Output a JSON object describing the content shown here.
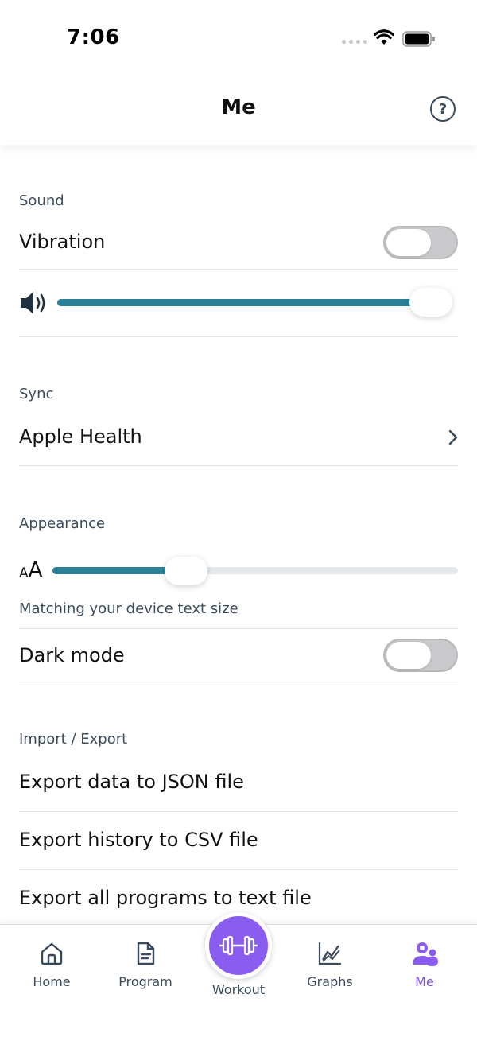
{
  "status_bar": {
    "time": "7:06"
  },
  "header": {
    "title": "Me",
    "help_label": "?"
  },
  "sound": {
    "section_label": "Sound",
    "vibration_label": "Vibration",
    "vibration_on": false,
    "volume_fraction": 0.98
  },
  "sync": {
    "section_label": "Sync",
    "apple_health_label": "Apple Health"
  },
  "appearance": {
    "section_label": "Appearance",
    "text_size_small_glyph": "A",
    "text_size_big_glyph": "A",
    "text_size_fraction": 0.33,
    "text_size_caption": "Matching your device text size",
    "dark_mode_label": "Dark mode",
    "dark_mode_on": false
  },
  "import_export": {
    "section_label": "Import / Export",
    "items": [
      {
        "label": "Export data to JSON file"
      },
      {
        "label": "Export history to CSV file"
      },
      {
        "label": "Export all programs to text file"
      }
    ]
  },
  "tab_bar": {
    "tabs": [
      {
        "label": "Home",
        "icon": "home-icon"
      },
      {
        "label": "Program",
        "icon": "document-icon"
      },
      {
        "label": "Workout",
        "icon": "dumbbell-icon"
      },
      {
        "label": "Graphs",
        "icon": "chart-icon"
      },
      {
        "label": "Me",
        "icon": "user-icon"
      }
    ],
    "active_tab": "Me",
    "accent_color": "#8a5cf0"
  },
  "colors": {
    "slider_fill": "#2a8096",
    "slider_track": "#e4e8ea",
    "toggle_off": "#c9c9cb",
    "section_text": "#3b4b5c"
  }
}
